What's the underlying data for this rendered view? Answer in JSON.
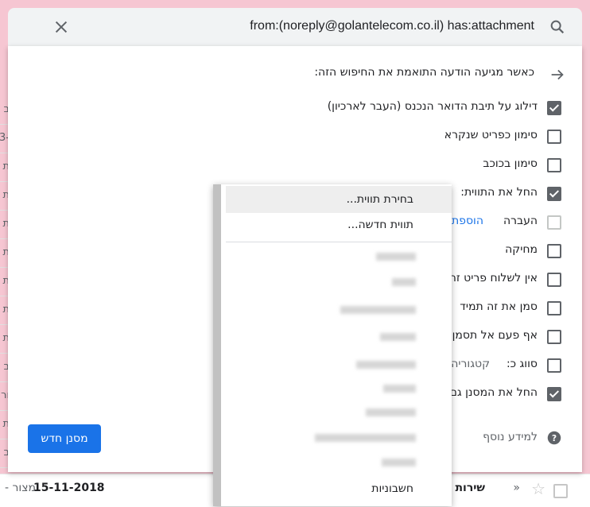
{
  "search": {
    "query": "from:(noreply@golantelecom.co.il) has:attachment"
  },
  "filter_panel": {
    "heading": "כאשר מגיעה הודעה התואמת את החיפוש הזה:",
    "options": [
      {
        "label": "דילוג על תיבת הדואר הנכנס (העבר לארכיון)",
        "checked": true
      },
      {
        "label": "סימון כפריט שנקרא",
        "checked": false
      },
      {
        "label": "סימון בכוכב",
        "checked": false
      },
      {
        "label": "החל את התווית:",
        "checked": true
      },
      {
        "label": "העברה",
        "checked": false,
        "disabled": true,
        "link": "הוספת"
      },
      {
        "label": "מחיקה",
        "checked": false
      },
      {
        "label": "אין לשלוח פריט זה",
        "checked": false
      },
      {
        "label": "סמן את זה תמיד",
        "checked": false
      },
      {
        "label": "אף פעם אל תסמן",
        "checked": false
      },
      {
        "label": "סווג כ:",
        "checked": false,
        "value": "קטגוריה..."
      },
      {
        "label": "החל את המסנן גם",
        "checked": true
      }
    ],
    "learn_more": "למידע נוסף",
    "create_button": "מסנן חדש"
  },
  "dropdown": {
    "items": [
      "בחירת תווית...",
      "תווית חדשה..."
    ],
    "last_item": "חשבוניות"
  },
  "background": {
    "row_date": "15-11-2018",
    "row_subject": "שירות לק...ית גולן טלקום לתאריך",
    "row_dash": "- מצור",
    "row_importance": "»",
    "left_strip": [
      "ב",
      "3-",
      "ת",
      "ת",
      "ת",
      "ת",
      "ת",
      "ת",
      "ת",
      "ב",
      "ור",
      "ת",
      "ב"
    ]
  }
}
